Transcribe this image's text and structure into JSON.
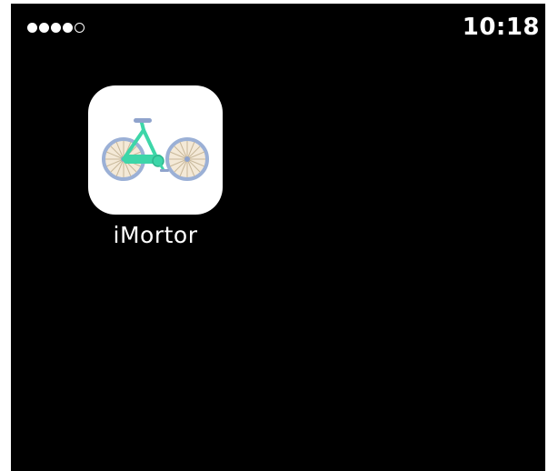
{
  "status_bar": {
    "signal_bars_filled": 4,
    "signal_bars_total": 5,
    "time": "10:18"
  },
  "home_screen": {
    "apps": [
      {
        "label": "iMortor",
        "icon": "bicycle-icon",
        "colors": {
          "frame": "#3dd6a8",
          "wheel_rim": "#9bb0d6",
          "wheel_fill": "#f4e9d7",
          "spokes": "#c8b89a",
          "seat": "#8fa3cc"
        }
      }
    ]
  },
  "colors": {
    "background": "#000000",
    "icon_background": "#ffffff",
    "text": "#ffffff"
  }
}
